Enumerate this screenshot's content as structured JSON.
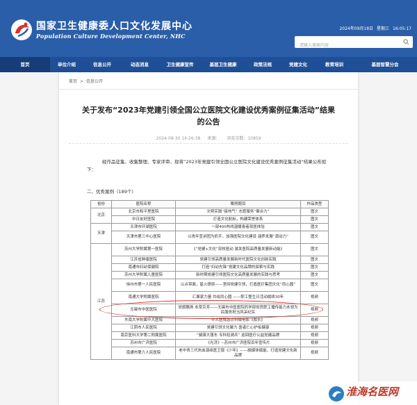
{
  "header": {
    "title": "国家卫生健康委人口文化发展中心",
    "subtitle": "Population Culture Development Center, NHC",
    "date": "2024年09月18日",
    "weekday": "星期三",
    "time": "16:05:17",
    "search_placeholder": "请输入搜索内容"
  },
  "nav": {
    "items": [
      {
        "label": "首页"
      },
      {
        "label": "单位介绍"
      },
      {
        "label": "信息公开"
      },
      {
        "label": "动态消息"
      },
      {
        "label": "卫生健康宣传"
      },
      {
        "label": "基层卫生健康"
      },
      {
        "label": "政策法规"
      },
      {
        "label": "党建文化"
      },
      {
        "label": "教育培训"
      },
      {
        "label": "基层智慧分会"
      }
    ]
  },
  "breadcrumb": {
    "home": "首页",
    "sep": ">",
    "current": "信息公开"
  },
  "article": {
    "title": "关于发布“2023年党建引领全国公立医院文化建设优秀案例征集活动”结果的公告",
    "time": "2024-08-30 14:26:38",
    "source": "来源：",
    "views": "浏览次数：10859",
    "intro": "经作品征集、收集整理、专家评审，现将“2023年党建引领全国公立医院文化建设优秀案例征集活动”结果公布如下：",
    "section": "二、优秀案例（189个）"
  },
  "table": {
    "headers": [
      "省份",
      "医院名称",
      "案例题目",
      "作品类型"
    ],
    "groups": [
      {
        "province": "北京",
        "rows": [
          {
            "hospital": "北京市和平里医院",
            "title": "文明实践“接地气” 志愿服务“聚合力”",
            "type": "图文"
          },
          {
            "hospital": "中日友好医院",
            "title": "打造文化航标，构建荣誉体系",
            "type": "图文"
          }
        ]
      },
      {
        "province": "天津",
        "rows": [
          {
            "hospital": "天津市环湖医院",
            "title": "一部400热线温暖患者就医体验",
            "type": "图文"
          },
          {
            "hospital": "天津市第三中心医院",
            "title": "以青年宣讲团为抓手，加强医院文化建设 涵养发展“源动力”",
            "type": "图文",
            "tall": true
          }
        ]
      },
      {
        "province": "江苏",
        "rows": [
          {
            "hospital": "苏州大学附属第一医院",
            "title": "《“党建+文化”双核驱动 激发医院高质量发展新动能》",
            "type": "图文",
            "tall": true
          },
          {
            "hospital": "江苏省肿瘤医院",
            "title": "党建引领高质量发展新时代医院文化创新实践",
            "type": "图文"
          },
          {
            "hospital": "南通市妇幼保健院",
            "title": "打造“妇幼先锋”党建文化品牌的探索与实践",
            "type": "图文"
          },
          {
            "hospital": "苏州大学附属儿童医院",
            "title": "新时期党建引领医院文化高质量发展的实践与思考",
            "type": "图文"
          },
          {
            "hospital": "徐州市第一人民医院",
            "title": "以点带面，星火燎原——坚持党建引领，打造医疗集团文化“同心圆”",
            "type": "图文",
            "tall": true
          },
          {
            "hospital": "南通大学附属医院",
            "title": "汇聚家力量 共绘同心圆 ——职工整生日活动赋续30年",
            "type": "视频",
            "tall": true
          },
          {
            "hospital": "无锡市中医医院",
            "title": "党旗飘扬 本草芬芳——无锡市中医医院药学部党员职工播传能力本领为民服务担当风采纪实",
            "type": "视频",
            "tall": true
          },
          {
            "hospital": "东南大学附属中大医院",
            "title": "中大医院急诊科微电影《成长》",
            "type": "视频"
          },
          {
            "hospital": "江阴市人民医院",
            "title": "党建引领文化聚力 医者仁心护佑健康",
            "type": "视频"
          },
          {
            "hospital": "南京医科大学第二附属医院",
            "title": "“健康大篷车 专科轻骑兵” 巡回医疗公益党建品牌",
            "type": "视频"
          },
          {
            "hospital": "苏州市广济医院",
            "title": "《光济》--苏州市广济医院百年宣传片",
            "type": "视频"
          },
          {
            "hospital": "南通市第六人民医院",
            "title": "老中青三代热血演绎医卫版《少年》——融媒体赋能，打造党建文化新品牌",
            "type": "视频",
            "tall": true
          }
        ]
      }
    ]
  },
  "watermark": {
    "text": "淮海名医网"
  },
  "colors": {
    "header_bg": "#2a5ea8",
    "nav_bg": "#1f4f96",
    "highlight": "#d8342a"
  }
}
